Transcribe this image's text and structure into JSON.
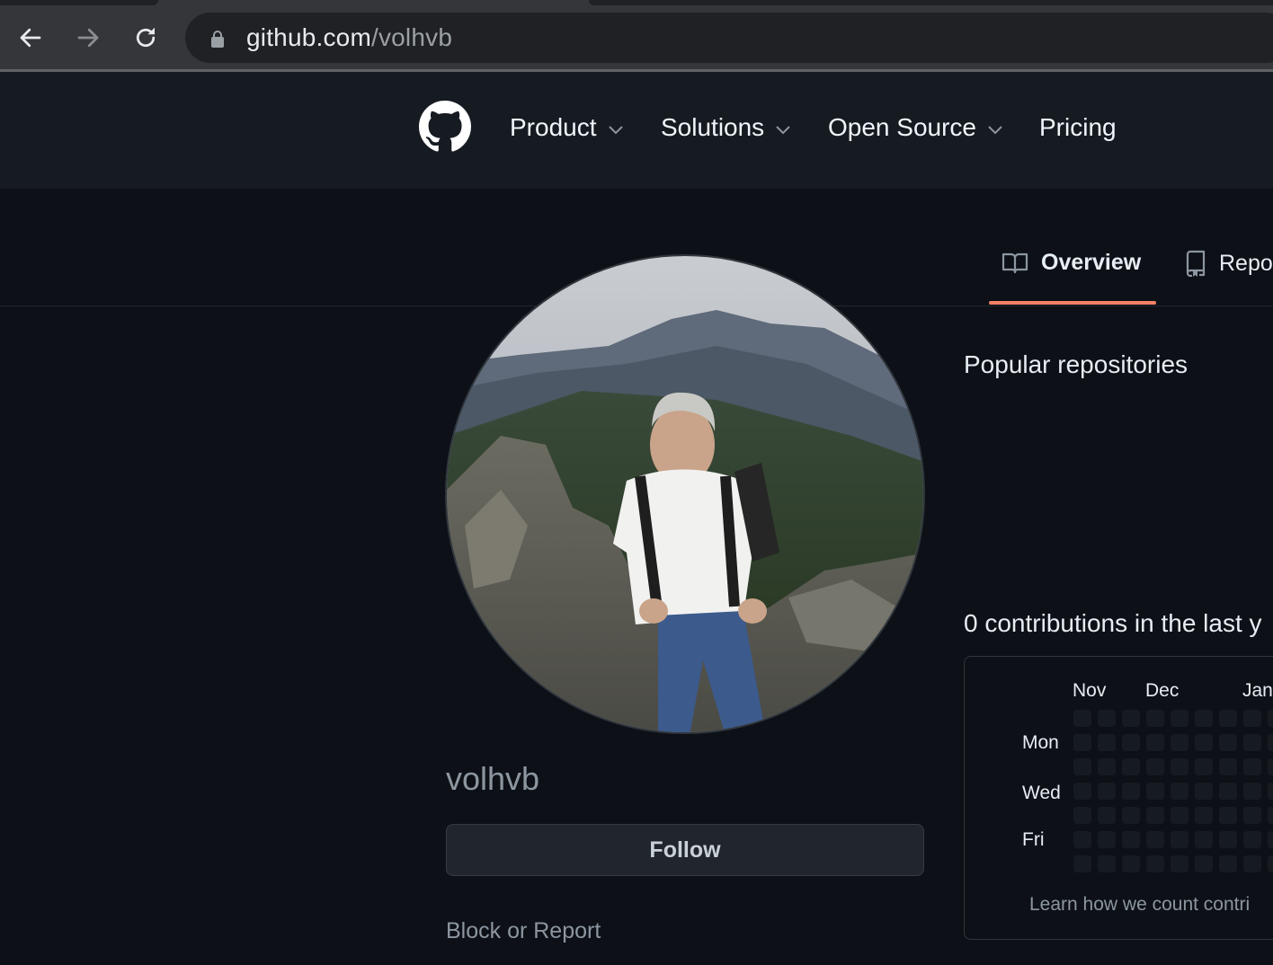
{
  "browser": {
    "url_host": "github.com",
    "url_path": "/volhvb",
    "back_icon": "arrow-left-icon",
    "forward_icon": "arrow-right-icon",
    "reload_icon": "reload-icon",
    "lock_icon": "lock-icon"
  },
  "header": {
    "logo_icon": "github-mark-icon",
    "menu": [
      {
        "label": "Product",
        "has_dropdown": true
      },
      {
        "label": "Solutions",
        "has_dropdown": true
      },
      {
        "label": "Open Source",
        "has_dropdown": true
      },
      {
        "label": "Pricing",
        "has_dropdown": false
      }
    ]
  },
  "tabs": [
    {
      "label": "Overview",
      "icon": "book-icon",
      "active": true
    },
    {
      "label": "Repo",
      "icon": "repo-icon",
      "active": false
    }
  ],
  "profile": {
    "username": "volhvb",
    "avatar_alt": "Profile photo of a man with a backpack on a rocky mountain overlook",
    "follow_label": "Follow",
    "block_label": "Block or Report"
  },
  "main": {
    "popular_title": "Popular repositories",
    "contributions_title": "0 contributions in the last y",
    "months": [
      "Nov",
      "Dec",
      "Jan"
    ],
    "days": [
      "Mon",
      "Wed",
      "Fri"
    ],
    "learn_text": "Learn how we count contri",
    "empty_cell_color": "#161b22"
  },
  "colors": {
    "accent_underline": "#f78166",
    "bg": "#0d1117",
    "header_bg": "#161b22"
  }
}
